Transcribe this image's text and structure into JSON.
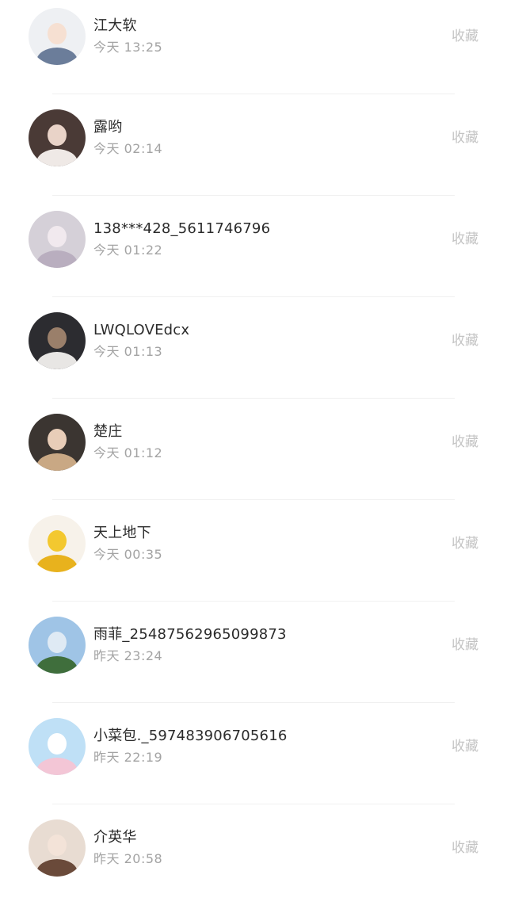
{
  "favorites": {
    "items": [
      {
        "name": "江大软",
        "time": "今天 13:25",
        "action": "收藏",
        "avatar_colors": {
          "bg": "#eef0f3",
          "face": "#f6e0d2",
          "body": "#6b7d9a"
        }
      },
      {
        "name": "露哟",
        "time": "今天 02:14",
        "action": "收藏",
        "avatar_colors": {
          "bg": "#4a3a36",
          "face": "#e9d3c8",
          "body": "#efe9e6"
        }
      },
      {
        "name": "138***428_5611746796",
        "time": "今天 01:22",
        "action": "收藏",
        "avatar_colors": {
          "bg": "#d5d0d8",
          "face": "#f1e9ee",
          "body": "#b9aebf"
        }
      },
      {
        "name": "LWQLOVEdcx",
        "time": "今天 01:13",
        "action": "收藏",
        "avatar_colors": {
          "bg": "#2c2c30",
          "face": "#9a7f6a",
          "body": "#e8e6e4"
        }
      },
      {
        "name": "楚庄",
        "time": "今天 01:12",
        "action": "收藏",
        "avatar_colors": {
          "bg": "#3b3531",
          "face": "#e8cdb8",
          "body": "#c9a884"
        }
      },
      {
        "name": "天上地下",
        "time": "今天 00:35",
        "action": "收藏",
        "avatar_colors": {
          "bg": "#f7f2ea",
          "face": "#f3c82f",
          "body": "#e8b21d"
        }
      },
      {
        "name": "雨菲_25487562965099873",
        "time": "昨天 23:24",
        "action": "收藏",
        "avatar_colors": {
          "bg": "#9fc4e6",
          "face": "#dfeaf4",
          "body": "#3f6e3c"
        }
      },
      {
        "name": "小菜包._597483906705616",
        "time": "昨天 22:19",
        "action": "收藏",
        "avatar_colors": {
          "bg": "#bfe0f6",
          "face": "#ffffff",
          "body": "#f3c6d6"
        }
      },
      {
        "name": "介英华",
        "time": "昨天 20:58",
        "action": "收藏",
        "avatar_colors": {
          "bg": "#e8dcd2",
          "face": "#f3e3d8",
          "body": "#6a4a3a"
        }
      }
    ]
  }
}
